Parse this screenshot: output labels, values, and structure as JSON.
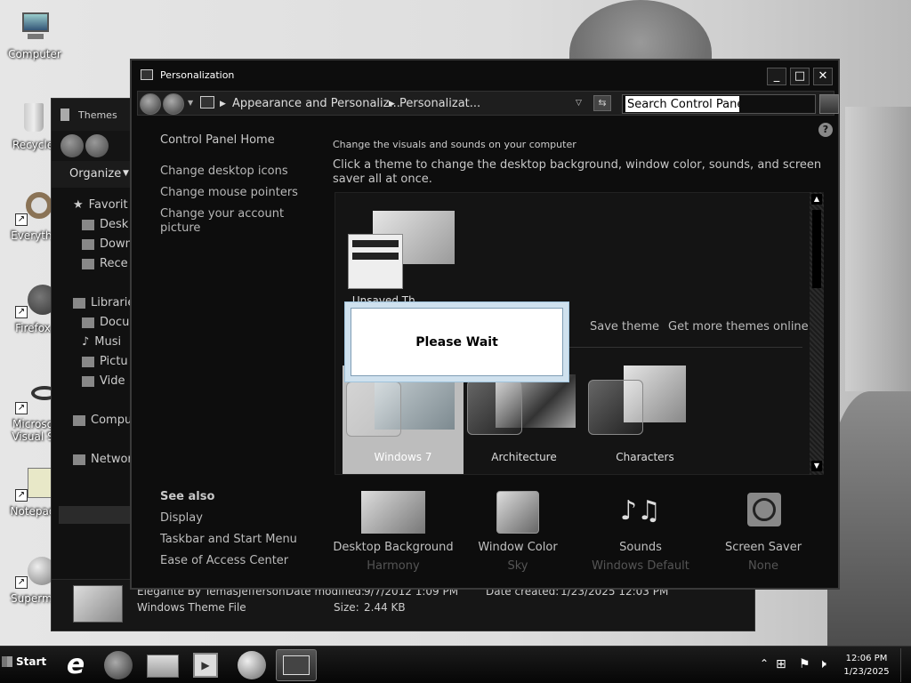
{
  "desktop": {
    "icons": [
      {
        "label": "Computer"
      },
      {
        "label": "Recycle"
      },
      {
        "label": "Everythi"
      },
      {
        "label": "Firefox"
      },
      {
        "label": "Microso"
      },
      {
        "label": "Visual S"
      },
      {
        "label": "Notepad"
      },
      {
        "label": "Supermi"
      }
    ]
  },
  "explorer": {
    "title": "Themes",
    "organize": "Organize",
    "nav": {
      "favorites": "Favorit",
      "desktop": "Desk",
      "downloads": "Down",
      "recent": "Rece",
      "libraries": "Librarie",
      "documents": "Docu",
      "music": "Musi",
      "pictures": "Pictu",
      "videos": "Vide",
      "computer": "Compu",
      "network": "Networ"
    },
    "details": {
      "filename": "Elegante By TemasJefferson",
      "date_modified_label": "Date modified:",
      "date_modified": "9/7/2012 1:09 PM",
      "date_created_label": "Date created:",
      "date_created": "1/23/2025 12:03 PM",
      "type": "Windows Theme File",
      "size_label": "Size:",
      "size": "2.44 KB"
    }
  },
  "personalization": {
    "title": "Personalization",
    "breadcrumb": [
      "Appearance and Personaliz...",
      "Personalizat..."
    ],
    "search_placeholder": "Search Control Panel",
    "left": {
      "home": "Control Panel Home",
      "links": [
        "Change desktop icons",
        "Change mouse pointers",
        "Change your account picture"
      ],
      "see_also_title": "See also",
      "see_also": [
        "Display",
        "Taskbar and Start Menu",
        "Ease of Access Center"
      ]
    },
    "heading": "Change the visuals and sounds on your computer",
    "description": "Click a theme to change the desktop background, window color, sounds, and screen saver all at once.",
    "my_theme_partial": "Unsaved Th...",
    "save_theme": "Save theme",
    "get_more": "Get more themes online",
    "themes": [
      {
        "name": "Windows 7",
        "selected": true
      },
      {
        "name": "Architecture",
        "selected": false
      },
      {
        "name": "Characters",
        "selected": false
      }
    ],
    "dialog_text": "Please Wait",
    "bottom": [
      {
        "label": "Desktop Background",
        "value": "Harmony",
        "icon": "picture-icon"
      },
      {
        "label": "Window Color",
        "value": "Sky",
        "icon": "color-swatch-icon"
      },
      {
        "label": "Sounds",
        "value": "Windows Default",
        "icon": "music-notes-icon"
      },
      {
        "label": "Screen Saver",
        "value": "None",
        "icon": "no-screensaver-icon"
      }
    ]
  },
  "taskbar": {
    "start": "Start",
    "time": "12:06 PM",
    "date": "1/23/2025"
  }
}
